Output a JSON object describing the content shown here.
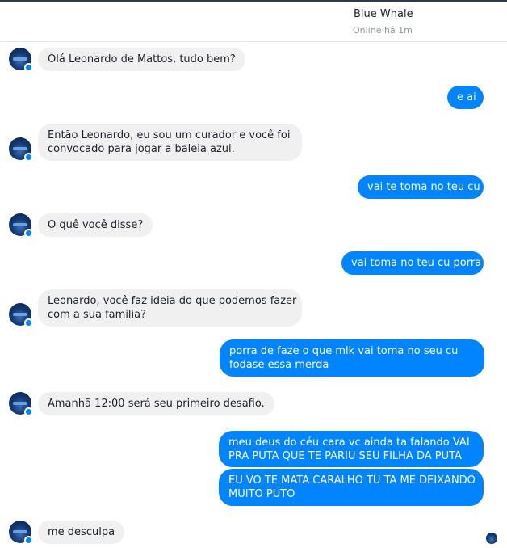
{
  "header": {
    "title": "Blue Whale",
    "status": "Online há 1m"
  },
  "messages": [
    {
      "from": "them",
      "lines": [
        "Olá Leonardo de Mattos, tudo bem?"
      ]
    },
    {
      "from": "me",
      "lines": [
        "e ai"
      ]
    },
    {
      "from": "them",
      "lines": [
        "Então Leonardo, eu sou um curador e você foi",
        "convocado para jogar a baleia azul."
      ]
    },
    {
      "from": "me",
      "lines": [
        "vai te toma no teu cu"
      ]
    },
    {
      "from": "them",
      "lines": [
        "O quê você disse?"
      ]
    },
    {
      "from": "me",
      "lines": [
        "vai toma no teu cu porra"
      ]
    },
    {
      "from": "them",
      "lines": [
        "Leonardo, você faz ideia do que podemos fazer",
        "com a sua família?"
      ]
    },
    {
      "from": "me",
      "lines": [
        "porra de faze o que mlk vai toma no seu cu",
        "fodase essa merda"
      ]
    },
    {
      "from": "them",
      "lines": [
        "Amanhã 12:00 será seu primeiro desafio."
      ]
    },
    {
      "from": "me",
      "lines": [
        "meu deus do céu cara vc ainda ta falando VAI",
        "PRA PUTA QUE TE PARIU SEU FILHA DA PUTA"
      ]
    },
    {
      "from": "me",
      "lines": [
        "EU VO TE MATA CARALHO TU TA ME DEIXANDO",
        "MUITO PUTO"
      ]
    },
    {
      "from": "them",
      "lines": [
        "me desculpa"
      ]
    }
  ],
  "avatar_icon": "blue-whale-avatar",
  "badge_icon": "messenger-badge-icon",
  "colors": {
    "outgoing_bubble": "#0084ff",
    "incoming_bubble": "#f1f0f0",
    "text_dark": "#1d2129",
    "status_gray": "#90949c"
  }
}
